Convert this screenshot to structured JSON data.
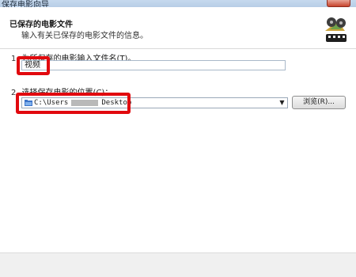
{
  "window": {
    "title": "保存电影向导"
  },
  "header": {
    "title": "已保存的电影文件",
    "subtitle": "输入有关已保存的电影文件的信息。"
  },
  "step1": {
    "number": "1.",
    "label": "为所保存的电影输入文件名(T)。",
    "value": "视频"
  },
  "step2": {
    "number": "2.",
    "label": "选择保存电影的位置(C)：",
    "location_prefix": "C:\\Users",
    "location_suffix": "Desktop"
  },
  "buttons": {
    "browse": "浏览(R)..."
  },
  "icons": {
    "close": "close-icon",
    "logo": "film-reel-icon",
    "folder": "folder-icon",
    "dropdown": "chevron-down-icon"
  },
  "colors": {
    "highlight": "#e1090e"
  }
}
